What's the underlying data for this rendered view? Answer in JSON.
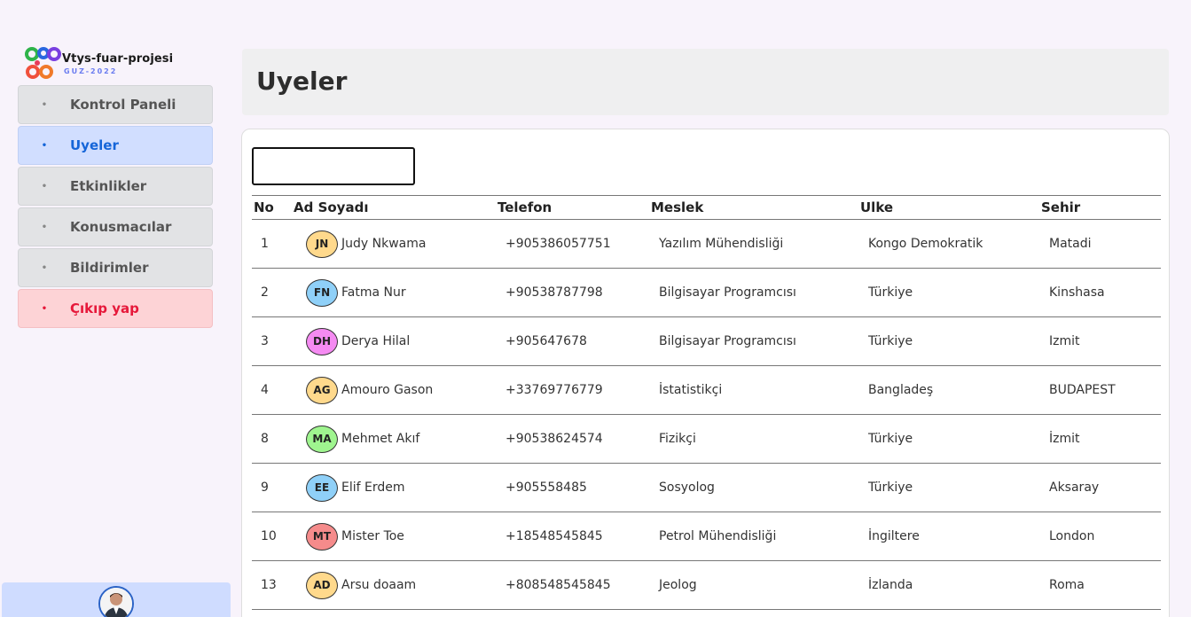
{
  "brand": {
    "title": "Vtys-fuar-projesi",
    "subtitle": "GUZ-2022"
  },
  "nav": [
    {
      "label": "Kontrol Paneli",
      "state": "default"
    },
    {
      "label": "Uyeler",
      "state": "active"
    },
    {
      "label": "Etkinlikler",
      "state": "default"
    },
    {
      "label": "Konusmacılar",
      "state": "default"
    },
    {
      "label": "Bildirimler",
      "state": "default"
    },
    {
      "label": "Çıkıp yap",
      "state": "danger"
    }
  ],
  "page": {
    "title": "Uyeler"
  },
  "search": {
    "value": "",
    "placeholder": ""
  },
  "table": {
    "headers": [
      "No",
      "Ad Soyadı",
      "Telefon",
      "Meslek",
      "Ulke",
      "Sehir"
    ],
    "rows": [
      {
        "no": "1",
        "initials": "JN",
        "color": "#ffd98c",
        "name": "Judy Nkwama",
        "phone": "+905386057751",
        "job": "Yazılım Mühendisliği",
        "country": "Kongo Demokratik",
        "city": "Matadi"
      },
      {
        "no": "2",
        "initials": "FN",
        "color": "#8fd0f8",
        "name": "Fatma Nur",
        "phone": "+90538787798",
        "job": "Bilgisayar Programcısı",
        "country": "Türkiye",
        "city": "Kinshasa"
      },
      {
        "no": "3",
        "initials": "DH",
        "color": "#f58bf2",
        "name": "Derya Hilal",
        "phone": "+905647678",
        "job": "Bilgisayar Programcısı",
        "country": "Türkiye",
        "city": "Izmit"
      },
      {
        "no": "4",
        "initials": "AG",
        "color": "#ffd98c",
        "name": "Amouro Gason",
        "phone": "+33769776779",
        "job": "İstatistikçi",
        "country": "Bangladeş",
        "city": "BUDAPEST"
      },
      {
        "no": "8",
        "initials": "MA",
        "color": "#9ff58f",
        "name": "Mehmet Akıf",
        "phone": "+90538624574",
        "job": "Fizikçi",
        "country": "Türkiye",
        "city": "İzmit"
      },
      {
        "no": "9",
        "initials": "EE",
        "color": "#8fd0f8",
        "name": "Elif Erdem",
        "phone": "+905558485",
        "job": "Sosyolog",
        "country": "Türkiye",
        "city": "Aksaray"
      },
      {
        "no": "10",
        "initials": "MT",
        "color": "#f58b8b",
        "name": "Mister Toe",
        "phone": "+18548545845",
        "job": "Petrol Mühendisliği",
        "country": "İngiltere",
        "city": "London"
      },
      {
        "no": "13",
        "initials": "AD",
        "color": "#ffd98c",
        "name": "Arsu doaam",
        "phone": "+808548545845",
        "job": "Jeolog",
        "country": "İzlanda",
        "city": "Roma"
      }
    ]
  }
}
